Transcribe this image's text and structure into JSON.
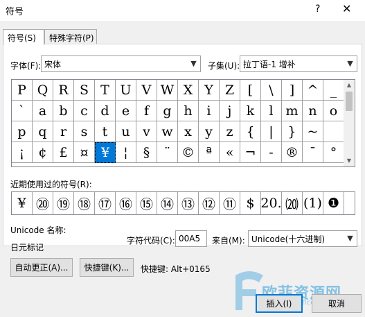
{
  "window": {
    "title": "符号",
    "help_label": "?",
    "close_label": "✕"
  },
  "tabs": [
    {
      "label": "符号(S)",
      "active": true
    },
    {
      "label": "特殊字符(P)",
      "active": false
    }
  ],
  "font": {
    "label": "字体(F):",
    "value": "宋体"
  },
  "subset": {
    "label": "子集(U):",
    "value": "拉丁语-1 增补"
  },
  "symbols": [
    "P",
    "Q",
    "R",
    "S",
    "T",
    "U",
    "V",
    "W",
    "X",
    "Y",
    "Z",
    "[",
    "\\",
    "]",
    "^",
    "_",
    "`",
    "a",
    "b",
    "c",
    "d",
    "e",
    "f",
    "g",
    "h",
    "i",
    "j",
    "k",
    "l",
    "m",
    "n",
    "o",
    "p",
    "q",
    "r",
    "s",
    "t",
    "u",
    "v",
    "w",
    "x",
    "y",
    "z",
    "{",
    "|",
    "}",
    "~",
    "",
    "¡",
    "¢",
    "£",
    "¤",
    "¥",
    "¦",
    "§",
    "¨",
    "©",
    "ª",
    "«",
    "¬",
    "-",
    "®",
    "¯",
    "°"
  ],
  "selected_index": 52,
  "recent": {
    "label": "近期使用过的符号(R):",
    "items": [
      "¥",
      "⑳",
      "⑲",
      "⑱",
      "⑰",
      "⑯",
      "⑮",
      "⑭",
      "⑬",
      "⑫",
      "⑪",
      "$",
      "20.",
      "⒇",
      "(1)",
      "❶"
    ]
  },
  "unicode_name": {
    "label": "Unicode 名称:",
    "value": "日元标记"
  },
  "char_code": {
    "label": "字符代码(C):",
    "value": "00A5"
  },
  "from": {
    "label": "来自(M):",
    "value": "Unicode(十六进制)"
  },
  "buttons": {
    "autocorrect": "自动更正(A)...",
    "shortcut_key": "快捷键(K)...",
    "shortcut_text": "快捷键: Alt+0165",
    "insert": "插入(I)",
    "cancel": "取消"
  },
  "watermark": {
    "text": "欧菲资源网",
    "sub": "www.office26.com"
  },
  "colors": {
    "selection": "#0078d7",
    "primary_border": "#0078d7"
  }
}
